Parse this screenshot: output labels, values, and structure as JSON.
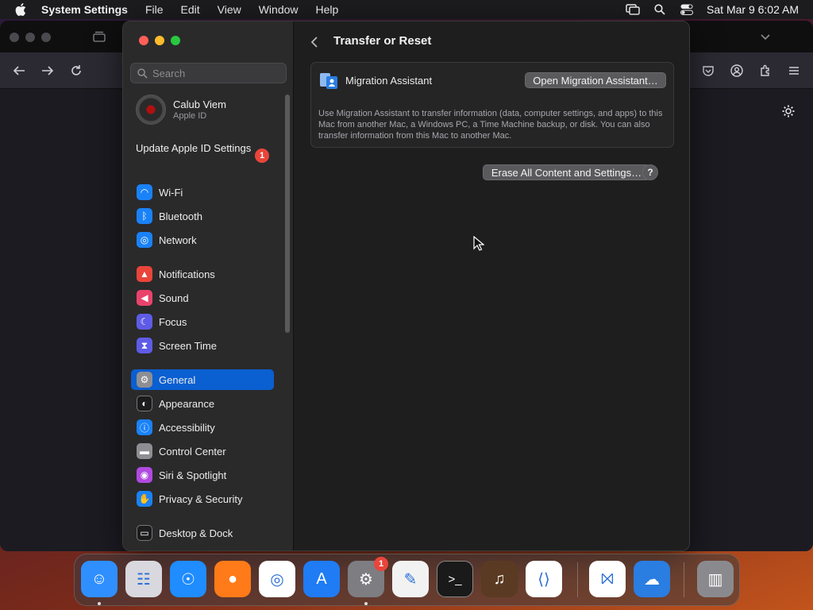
{
  "menubar": {
    "app_name": "System Settings",
    "menus": [
      "File",
      "Edit",
      "View",
      "Window",
      "Help"
    ],
    "clock": "Sat Mar 9  6:02 AM",
    "status_icons": [
      "screen-mirroring-icon",
      "spotlight-search-icon",
      "control-center-icon"
    ]
  },
  "sidebar": {
    "search_placeholder": "Search",
    "account": {
      "name": "Calub Viem",
      "subtitle": "Apple ID"
    },
    "update": {
      "label": "Update Apple ID Settings",
      "badge": "1"
    },
    "items": [
      {
        "label": "Wi-Fi",
        "icon": "wifi-icon",
        "color": "#1a82f7"
      },
      {
        "label": "Bluetooth",
        "icon": "bluetooth-icon",
        "color": "#1a82f7"
      },
      {
        "label": "Network",
        "icon": "globe-icon",
        "color": "#1a82f7"
      },
      {
        "label": "Notifications",
        "icon": "bell-icon",
        "color": "#e9453a"
      },
      {
        "label": "Sound",
        "icon": "speaker-icon",
        "color": "#e9436b"
      },
      {
        "label": "Focus",
        "icon": "moon-icon",
        "color": "#5e5ce6"
      },
      {
        "label": "Screen Time",
        "icon": "hourglass-icon",
        "color": "#5e5ce6"
      },
      {
        "label": "General",
        "icon": "gear-icon",
        "color": "#8e8e93",
        "selected": true
      },
      {
        "label": "Appearance",
        "icon": "appearance-icon",
        "color": "#1c1c1e"
      },
      {
        "label": "Accessibility",
        "icon": "accessibility-icon",
        "color": "#1a82f7"
      },
      {
        "label": "Control Center",
        "icon": "toggles-icon",
        "color": "#8e8e93"
      },
      {
        "label": "Siri & Spotlight",
        "icon": "siri-icon",
        "color": "#b04ae0"
      },
      {
        "label": "Privacy & Security",
        "icon": "hand-icon",
        "color": "#1a82f7"
      },
      {
        "label": "Desktop & Dock",
        "icon": "dock-icon",
        "color": "#1c1c1e"
      }
    ]
  },
  "main": {
    "title": "Transfer or Reset",
    "migration": {
      "label": "Migration Assistant",
      "button": "Open Migration Assistant…",
      "description": "Use Migration Assistant to transfer information (data, computer settings, and apps) to this Mac from another Mac, a Windows PC, a Time Machine backup, or disk. You can also transfer information from this Mac to another Mac."
    },
    "erase_button": "Erase All Content and Settings…",
    "help_label": "?"
  },
  "dock": {
    "apps": [
      {
        "name": "Finder",
        "icon": "finder-icon",
        "color": "#2f8fff"
      },
      {
        "name": "Launchpad",
        "icon": "launchpad-icon",
        "color": "#d8d8de"
      },
      {
        "name": "Safari",
        "icon": "safari-icon",
        "color": "#1f8cff"
      },
      {
        "name": "Firefox",
        "icon": "firefox-icon",
        "color": "#ff7a18"
      },
      {
        "name": "Chrome",
        "icon": "chrome-icon",
        "color": "#ffffff"
      },
      {
        "name": "App Store",
        "icon": "app-store-icon",
        "color": "#1f7cf5"
      },
      {
        "name": "System Settings",
        "icon": "gear-icon",
        "color": "#7d7d82",
        "badge": "1"
      },
      {
        "name": "TextEdit",
        "icon": "textedit-icon",
        "color": "#f2f2f2"
      },
      {
        "name": "Terminal",
        "icon": "terminal-icon",
        "color": "#1a1a1a"
      },
      {
        "name": "GarageBand",
        "icon": "guitar-icon",
        "color": "#5a3a22"
      },
      {
        "name": "Visual Studio Code",
        "icon": "vscode-icon",
        "color": "#ffffff"
      },
      {
        "name": "Visual Studio",
        "icon": "visual-studio-icon",
        "color": "#ffffff"
      },
      {
        "name": "Weather",
        "icon": "weather-icon",
        "color": "#2a7de1"
      },
      {
        "name": "Trash",
        "icon": "trash-icon",
        "color": "#8a8a8e"
      }
    ]
  }
}
